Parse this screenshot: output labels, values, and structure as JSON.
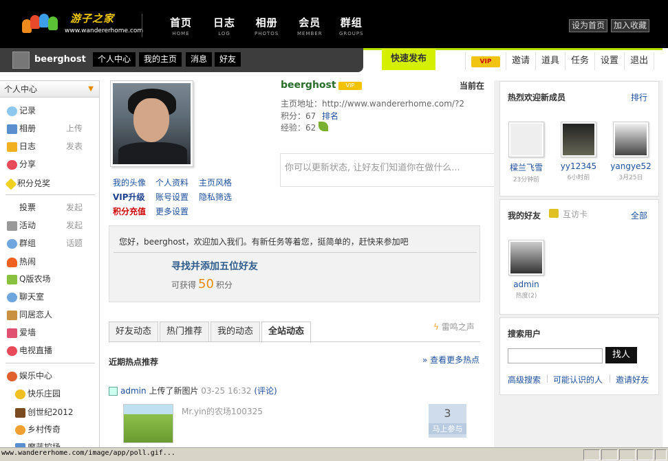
{
  "header": {
    "brand": "游子之家",
    "domain": "www.wandererhome.com",
    "nav": [
      {
        "zh": "首页",
        "en": "HOME"
      },
      {
        "zh": "日志",
        "en": "LOG"
      },
      {
        "zh": "相册",
        "en": "PHOTOS"
      },
      {
        "zh": "会员",
        "en": "MEMBER"
      },
      {
        "zh": "群组",
        "en": "GROUPS"
      }
    ],
    "set_home": "设为首页",
    "add_fav": "加入收藏"
  },
  "userbar": {
    "username": "beerghost",
    "buttons": [
      "个人中心",
      "我的主页",
      "消息",
      "好友"
    ],
    "quick_post": "快速发布",
    "vip": "VIP",
    "tools": [
      "邀请",
      "道具",
      "任务",
      "设置",
      "退出"
    ]
  },
  "sidebar": {
    "header": "个人中心",
    "items": [
      {
        "label": "记录",
        "sub": ""
      },
      {
        "label": "相册",
        "sub": "上传"
      },
      {
        "label": "日志",
        "sub": "发表"
      },
      {
        "label": "分享",
        "sub": ""
      },
      {
        "label": "积分兑奖",
        "sub": ""
      },
      {
        "label": "投票",
        "sub": "发起"
      },
      {
        "label": "活动",
        "sub": "发起"
      },
      {
        "label": "群组",
        "sub": "话题"
      },
      {
        "label": "热闹",
        "sub": ""
      },
      {
        "label": "Q版农场",
        "sub": ""
      },
      {
        "label": "聊天室",
        "sub": ""
      },
      {
        "label": "同居恋人",
        "sub": ""
      },
      {
        "label": "爱墙",
        "sub": ""
      },
      {
        "label": "电视直播",
        "sub": ""
      },
      {
        "label": "娱乐中心",
        "sub": ""
      },
      {
        "label": "快乐庄园",
        "sub": ""
      },
      {
        "label": "创世纪2012",
        "sub": ""
      },
      {
        "label": "乡村传奇",
        "sub": ""
      },
      {
        "label": "魔蓝控场",
        "sub": ""
      }
    ]
  },
  "profile": {
    "links": [
      [
        "我的头像",
        "个人资料",
        "主页风格"
      ],
      [
        "VIP升级",
        "账号设置",
        "隐私筛选"
      ],
      [
        "积分充值",
        "更多设置"
      ]
    ],
    "username": "beerghost",
    "vip_badge": "VIP",
    "current": "当前在",
    "url_label": "主页地址：http://www.wandererhome.com/?2",
    "points": "积分：67",
    "rank": "排名",
    "exp": "经验：62",
    "status_placeholder": "你可以更新状态, 让好友们知道你在做什么..."
  },
  "welcome": {
    "message": "您好，beerghost，欢迎加入我们。有新任务等着您，挺简单的，赶快来参加吧",
    "task": "寻找并添加五位好友",
    "reward_prefix": "可获得",
    "reward_value": "50",
    "reward_suffix": "积分"
  },
  "tabs": [
    "好友动态",
    "热门推荐",
    "我的动态",
    "全站动态"
  ],
  "leiming": "雷鸣之声",
  "hot": {
    "title": "近期热点推荐",
    "more": "» 查看更多热点",
    "feed_user": "admin",
    "feed_action": "上传了新图片",
    "feed_time": "03-25 16:32",
    "feed_comment": "(评论)",
    "item_name": "Mr.yin的农场100325",
    "join_count": "3",
    "join_label": "马上参与"
  },
  "right": {
    "new_members_title": "热烈欢迎新成员",
    "rank": "排行",
    "members": [
      {
        "name": "樑兰飞雪",
        "time": "23分钟前"
      },
      {
        "name": "yy12345",
        "time": "6小时前"
      },
      {
        "name": "yangye52",
        "time": "3月25日"
      }
    ],
    "friends_title": "我的好友",
    "visit_card": "互访卡",
    "all": "全部",
    "friend": {
      "name": "admin",
      "heat": "热度(2)"
    },
    "search_title": "搜索用户",
    "search_btn": "找人",
    "links": [
      "高级搜索",
      "可能认识的人",
      "邀请好友"
    ]
  },
  "statusbar": "www.wandererhome.com/image/app/poll.gif..."
}
